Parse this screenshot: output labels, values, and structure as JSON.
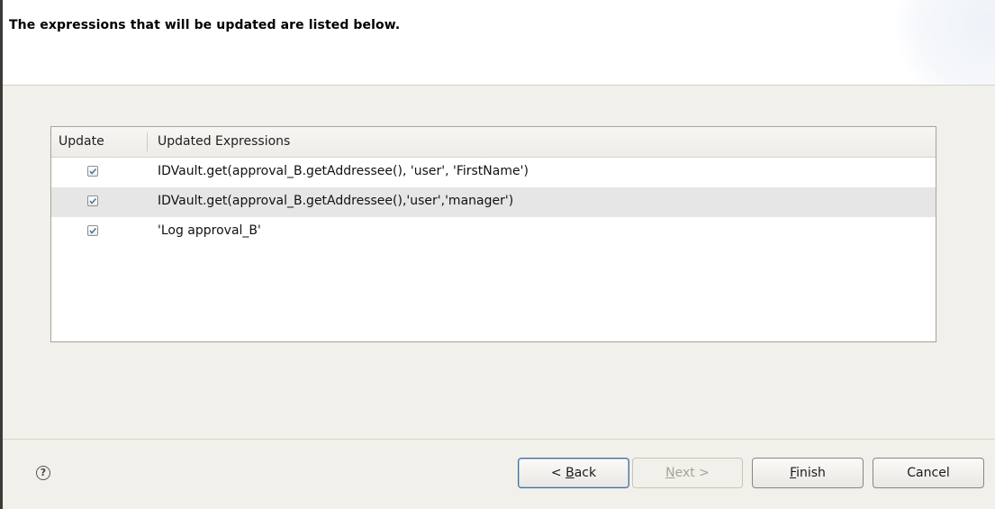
{
  "banner": {
    "title": "The expressions that will be updated are listed below."
  },
  "table": {
    "columns": [
      "Update",
      "Updated Expressions"
    ],
    "rows": [
      {
        "checked": true,
        "expression": "IDVault.get(approval_B.getAddressee(), 'user', 'FirstName')",
        "selected": false
      },
      {
        "checked": true,
        "expression": "IDVault.get(approval_B.getAddressee(),'user','manager')",
        "selected": true
      },
      {
        "checked": true,
        "expression": "'Log approval_B'",
        "selected": false
      }
    ]
  },
  "footer": {
    "help_icon": "?",
    "back": {
      "prefix": "< ",
      "mnemonic": "B",
      "rest": "ack"
    },
    "next": {
      "mnemonic": "N",
      "rest": "ext >",
      "enabled": false
    },
    "finish": {
      "mnemonic": "F",
      "rest": "inish"
    },
    "cancel": "Cancel"
  },
  "colors": {
    "default_button_border": "#4a6c95",
    "selected_row": "#e6e6e6",
    "dialog_background": "#f2f0eb"
  }
}
